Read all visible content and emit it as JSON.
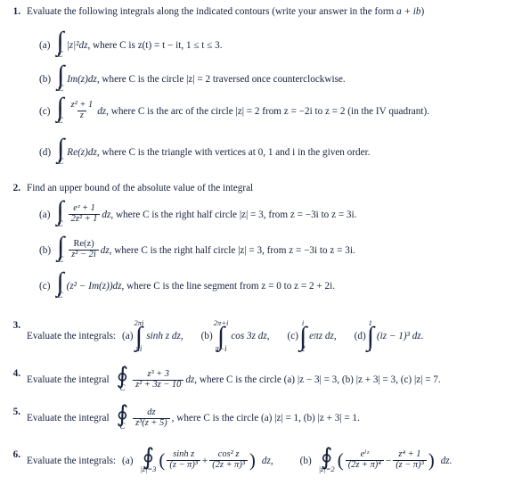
{
  "document": {
    "type": "math-problem-set",
    "topic": "Complex contour integration exercises",
    "text_color": "#16213c",
    "background_color": "#ffffff"
  },
  "symbols": {
    "integral": "∫",
    "contour_integral": "∮",
    "contour_label": "C",
    "pi": "π",
    "leq": "≤",
    "minus": "−",
    "plus": "+"
  },
  "problems": [
    {
      "number": "1.",
      "stem": "Evaluate the following integrals along the indicated contours (write your answer in the form ",
      "stem_math": "a + ib",
      "stem_tail": ")",
      "items": [
        {
          "label": "(a)",
          "integrand": "|z|²dz",
          "condition": ", where C is z(t) = t − it, 1 ≤ t ≤ 3."
        },
        {
          "label": "(b)",
          "integrand": "Im(z)dz",
          "condition": ", where C is the circle |z| = 2 traversed once counterclockwise."
        },
        {
          "label": "(c)",
          "numerator": "z² + 1",
          "denominator": "z",
          "integrand": "dz",
          "condition": ", where C is the arc of the circle |z| = 2 from z = −2i to z = 2 (in the IV quadrant)."
        },
        {
          "label": "(d)",
          "integrand": "Re(z)dz",
          "condition": ", where C is the triangle with vertices at 0, 1 and i in the given order."
        }
      ]
    },
    {
      "number": "2.",
      "stem": "Find an upper bound of the absolute value of the integral",
      "items": [
        {
          "label": "(a)",
          "numerator": "eᶻ + 1",
          "denominator": "2z² + 1",
          "integrand": "dz",
          "condition": ", where C is the right half circle |z| = 3, from z = −3i to z = 3i."
        },
        {
          "label": "(b)",
          "numerator": "Re(z)",
          "denominator": "z² − 2i",
          "integrand": "dz",
          "condition": ", where C is the right half circle |z| = 3, from z = −3i to z = 3i."
        },
        {
          "label": "(c)",
          "integrand": "(z² − Im(z))dz",
          "condition": ", where C is the line segment from z = 0 to z = 2 + 2i."
        }
      ]
    },
    {
      "number": "3.",
      "stem": "Evaluate the integrals:",
      "items": [
        {
          "label": "(a)",
          "lower_limit": "πi",
          "upper_limit": "2πi",
          "integrand": "sinh z dz,"
        },
        {
          "label": "(b)",
          "lower_limit": "π−i",
          "upper_limit": "2π+i",
          "integrand": "cos 3z dz,"
        },
        {
          "label": "(c)",
          "lower_limit": "2",
          "upper_limit": "i",
          "integrand": "eπz dz,"
        },
        {
          "label": "(d)",
          "lower_limit": "i",
          "upper_limit": "1",
          "integrand": "(iz − 1)³ dz."
        }
      ]
    },
    {
      "number": "4.",
      "stem": "Evaluate the integral",
      "numerator": "z³ + 3",
      "denominator": "z² + 3z − 10",
      "integrand": "dz",
      "condition": ", where C is the circle (a) |z − 3| = 3, (b) |z + 3| = 3, (c) |z| = 7."
    },
    {
      "number": "5.",
      "stem": "Evaluate the integral",
      "numerator": "dz",
      "denominator": "z³(z + 5)",
      "condition": ", where C is the circle (a) |z| = 1, (b) |z + 3| = 1."
    },
    {
      "number": "6.",
      "stem": "Evaluate the integrals:",
      "items": [
        {
          "label": "(a)",
          "contour": "|z|=3",
          "term1_num": "sinh z",
          "term1_den": "(z − π)³",
          "operator": "+",
          "term2_num": "cos² z",
          "term2_den": "(2z + π)³",
          "tail": "dz,"
        },
        {
          "label": "(b)",
          "contour": "|z|=2",
          "term1_num": "eⁱᶻ",
          "term1_den": "(2z + π)⁴",
          "operator": "−",
          "term2_num": "z⁴ + 1",
          "term2_den": "(z − π)³",
          "tail": "dz."
        }
      ]
    }
  ]
}
